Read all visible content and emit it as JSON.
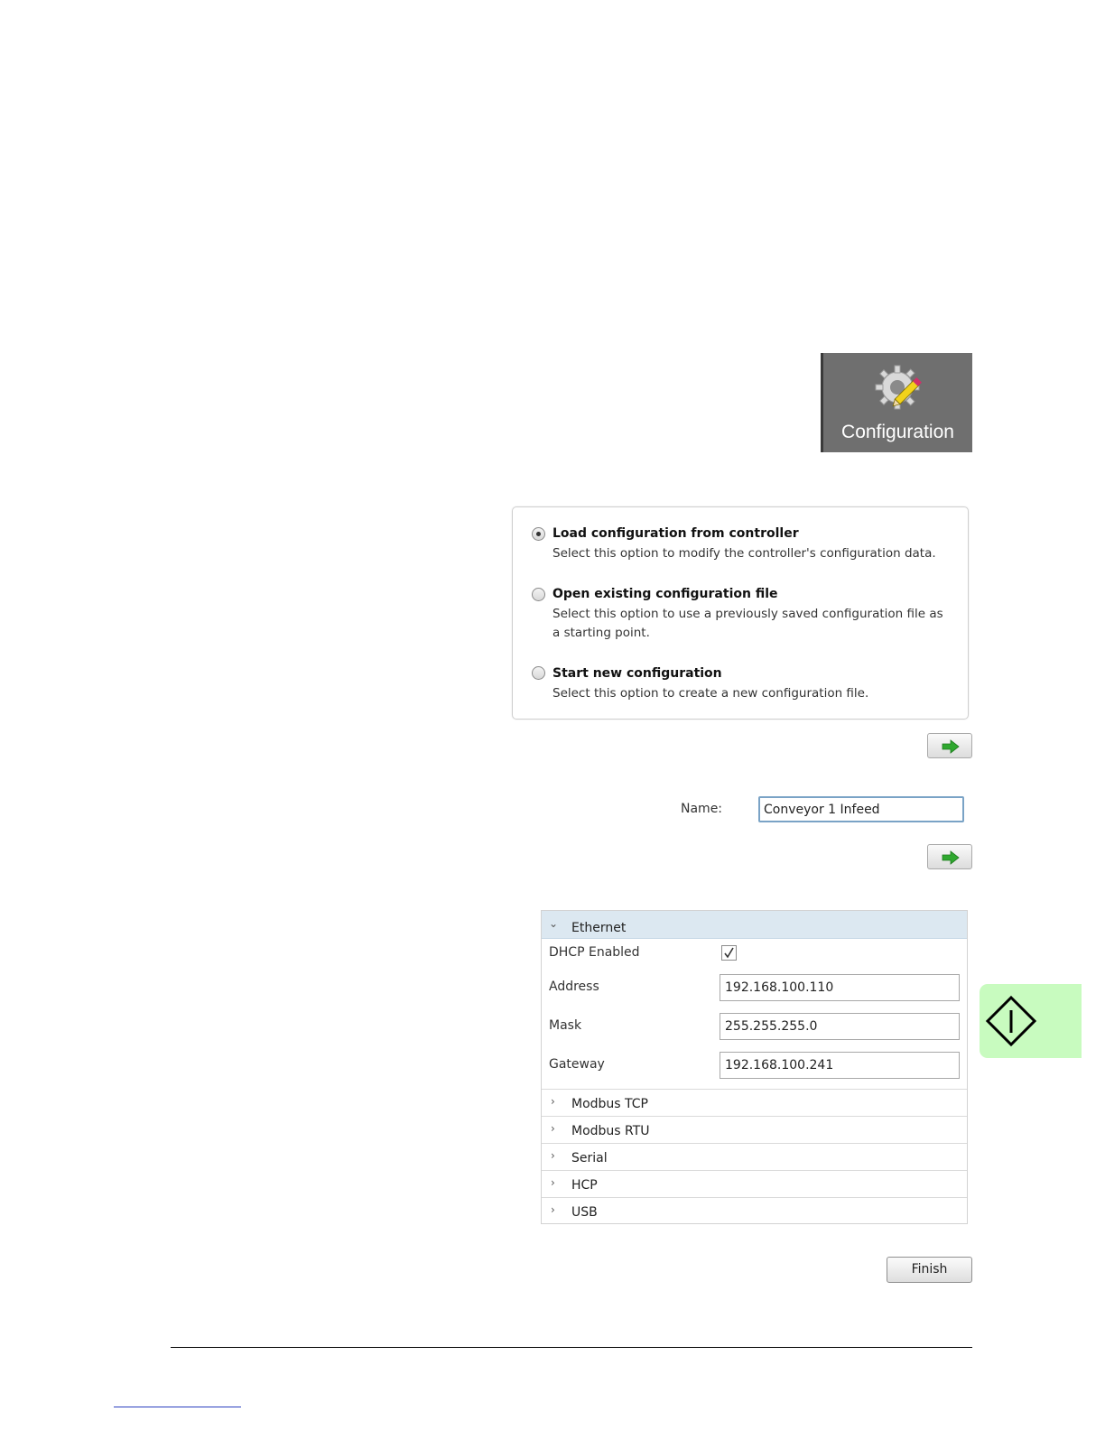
{
  "toolbar": {
    "configuration_label": "Configuration"
  },
  "options": [
    {
      "title": "Load configuration from controller",
      "description": "Select this option to modify the controller's configuration data.",
      "selected": true
    },
    {
      "title": "Open existing configuration file",
      "description": "Select this option to use a previously saved configuration file as a starting point.",
      "selected": false
    },
    {
      "title": "Start new configuration",
      "description": "Select this option to create a new configuration file.",
      "selected": false
    }
  ],
  "name_form": {
    "label": "Name:",
    "value": "Conveyor 1 Infeed"
  },
  "ethernet": {
    "header": "Ethernet",
    "dhcp_label": "DHCP Enabled",
    "dhcp_enabled": true,
    "fields": [
      {
        "label": "Address",
        "value": "192.168.100.110"
      },
      {
        "label": "Mask",
        "value": "255.255.255.0"
      },
      {
        "label": "Gateway",
        "value": "192.168.100.241"
      }
    ],
    "sections": [
      "Modbus TCP",
      "Modbus RTU",
      "Serial",
      "HCP",
      "USB"
    ]
  },
  "finish_label": "Finish",
  "colors": {
    "accent_green": "#2fa82f",
    "side_tab": "#c8fbbf",
    "ethernet_header": "#dce8f1"
  }
}
